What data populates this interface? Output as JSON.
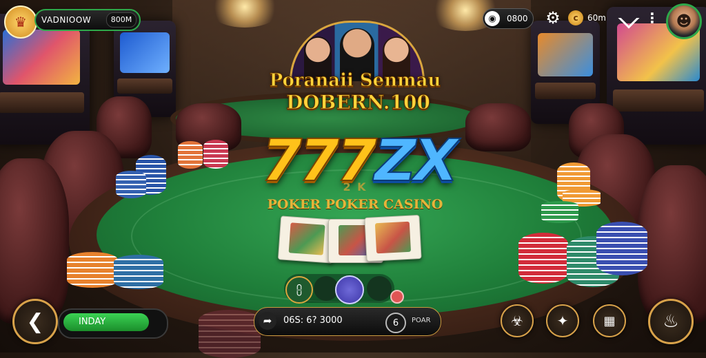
{
  "top_bar": {
    "player_name": "VADNIOOW",
    "player_value": "800M",
    "coins_value": "0800",
    "gems_value": "60m"
  },
  "banner": {
    "line1": "Poranaii Senmau",
    "line2": "DOBERN.100"
  },
  "logo": {
    "digits": "777",
    "letters": "ZX",
    "subtitle_faded": "2 K",
    "subtitle": "POKER POKER CASINO"
  },
  "bottom_bar": {
    "lobby_label": "INDAY",
    "bet_value": "06S: 6? 3000",
    "bet_right_label": "POAR"
  },
  "icons": {
    "back": "back-arrow-icon",
    "settings": "gear-icon",
    "menu": "more-dots-icon",
    "exit": "exit-icon"
  },
  "colors": {
    "accent_gold": "#d8a24a",
    "felt_green": "#1f7f3a",
    "lobby_green": "#27b13c"
  }
}
